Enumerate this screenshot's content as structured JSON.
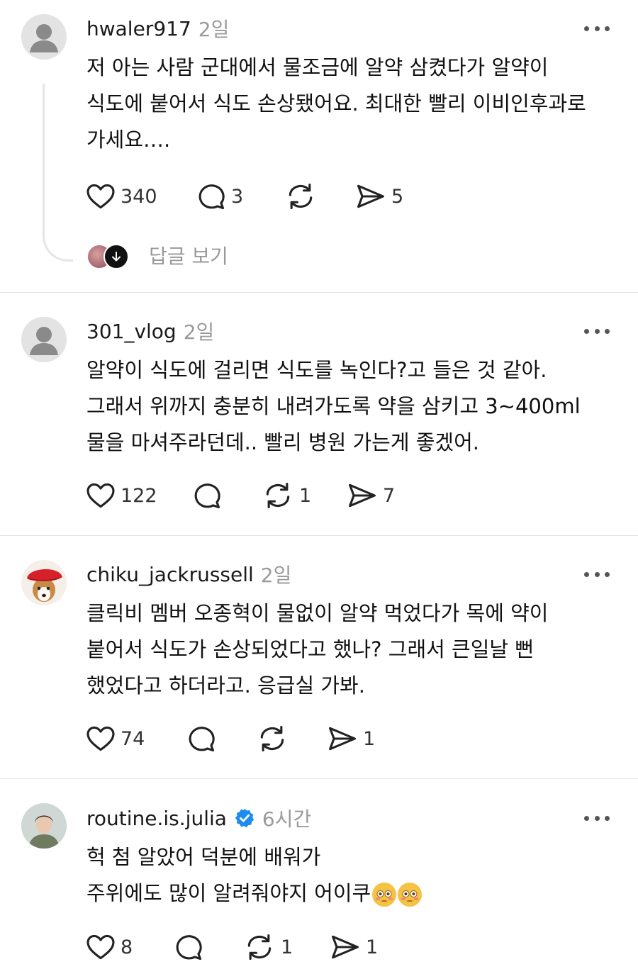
{
  "comments": [
    {
      "username": "hwaler917",
      "time": "2일",
      "avatar_icon": "default-person-avatar",
      "lines": [
        "저 아는 사람 군대에서 물조금에 알약 삼켰다가 알약이",
        "식도에 붙어서 식도 손상됐어요. 최대한 빨리 이비인후과로",
        "가세요…."
      ],
      "likes": "340",
      "replies": "3",
      "reposts": "",
      "shares": "5",
      "view_replies_label": "답글 보기"
    },
    {
      "username": "301_vlog",
      "time": "2일",
      "avatar_icon": "default-person-avatar",
      "lines": [
        "알약이 식도에 걸리면 식도를 녹인다?고 들은 것 같아.",
        "그래서 위까지 충분히 내려가도록 약을 삼키고 3~400ml",
        "물을 마셔주라던데.. 빨리 병원 가는게 좋겠어."
      ],
      "likes": "122",
      "replies": "",
      "reposts": "1",
      "shares": "7"
    },
    {
      "username": "chiku_jackrussell",
      "time": "2일",
      "avatar_icon": "dog-photo-avatar",
      "lines": [
        "클릭비 멤버 오종혁이 물없이 알약 먹었다가 목에 약이",
        "붙어서 식도가 손상되었다고 했나? 그래서 큰일날 뻔",
        "했었다고 하더라고. 응급실 가봐."
      ],
      "likes": "74",
      "replies": "",
      "reposts": "",
      "shares": "1"
    },
    {
      "username": "routine.is.julia",
      "time": "6시간",
      "verified": true,
      "avatar_icon": "person-photo-avatar",
      "lines": [
        "헉 첨 알았어 덕분에 배워가",
        "주위에도 많이 알려줘야지 어이쿠"
      ],
      "emoji": "flushed-face-emoji",
      "likes": "8",
      "replies": "",
      "reposts": "1",
      "shares": "1"
    }
  ],
  "icons": {
    "like": "heart-icon",
    "reply": "comment-bubble-icon",
    "repost": "repost-icon",
    "share": "send-icon",
    "more": "more-options-icon",
    "verified": "verified-badge-icon"
  },
  "colors": {
    "text": "#111111",
    "muted": "#9a9a9a",
    "verified": "#1d8cf0",
    "separator": "#e4e4e4"
  }
}
